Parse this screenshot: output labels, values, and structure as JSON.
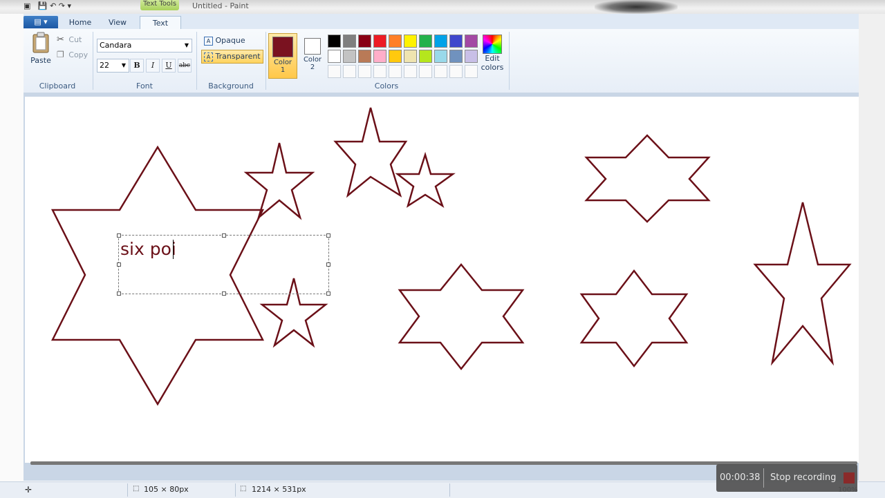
{
  "window": {
    "context_tab": "Text Tools",
    "title": "Untitled - Paint"
  },
  "ribbon_tabs": [
    {
      "label": "Home"
    },
    {
      "label": "View"
    },
    {
      "label": "Text"
    }
  ],
  "clipboard": {
    "paste": "Paste",
    "cut": "Cut",
    "copy": "Copy",
    "group": "Clipboard"
  },
  "font": {
    "family": "Candara",
    "size": "22",
    "bold": "B",
    "italic": "I",
    "underline": "U",
    "strike": "abc",
    "group": "Font"
  },
  "background": {
    "opaque": "Opaque",
    "transparent": "Transparent",
    "group": "Background",
    "selected": "Transparent"
  },
  "colors": {
    "color1_label": "Color",
    "color1_num": "1",
    "color2_label": "Color",
    "color2_num": "2",
    "color1_value": "#7a1220",
    "color2_value": "#ffffff",
    "edit_label": "Edit",
    "edit_label2": "colors",
    "group": "Colors",
    "palette_row1": [
      "#000000",
      "#7f7f7f",
      "#880015",
      "#ed1c24",
      "#ff7f27",
      "#fff200",
      "#22b14c",
      "#00a2e8",
      "#3f48cc",
      "#a349a4"
    ],
    "palette_row2": [
      "#ffffff",
      "#c3c3c3",
      "#b97a57",
      "#ffaec9",
      "#ffc90e",
      "#efe4b0",
      "#b5e61d",
      "#99d9ea",
      "#7092be",
      "#c8bfe7"
    ],
    "custom_slots": 10
  },
  "canvas": {
    "typed_text": "six poi",
    "stroke_color": "#6b1018"
  },
  "status": {
    "selection_size": "105 × 80px",
    "canvas_size": "1214 × 531px",
    "zoom": "100%"
  },
  "recorder": {
    "time": "00:00:38",
    "stop_label": "Stop recording"
  }
}
